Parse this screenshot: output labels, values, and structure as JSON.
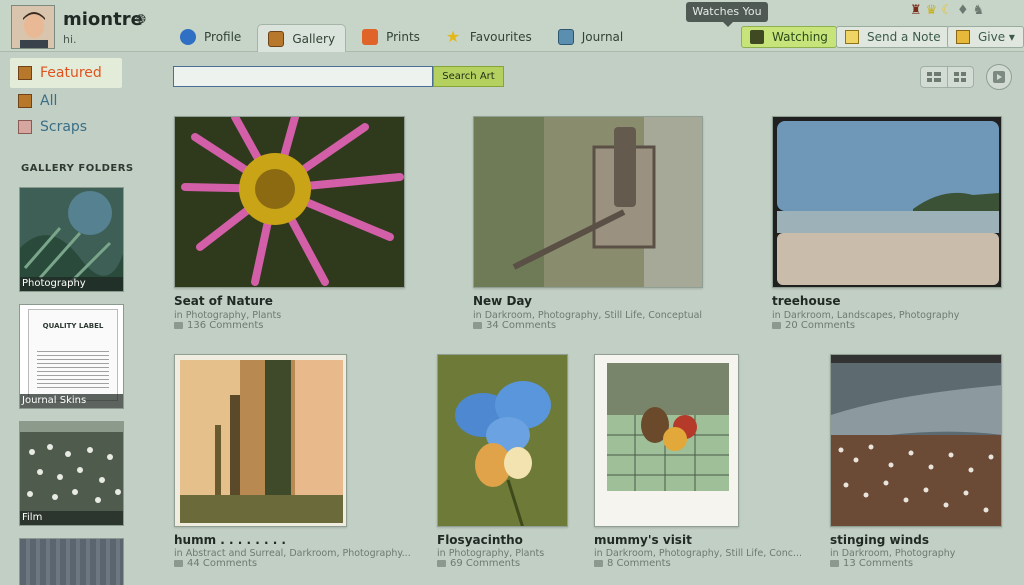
{
  "header": {
    "username": "miontre",
    "user_badge": "❂",
    "tagline": "hi.",
    "tooltip": "Watches You",
    "tabs": [
      {
        "label": "Profile"
      },
      {
        "label": "Gallery"
      },
      {
        "label": "Prints"
      },
      {
        "label": "Favourites"
      },
      {
        "label": "Journal"
      }
    ],
    "actions": {
      "watching": "Watching",
      "send_note": "Send a Note",
      "give": "Give ▾"
    }
  },
  "sidebar": {
    "items": [
      {
        "label": "Featured"
      },
      {
        "label": "All"
      },
      {
        "label": "Scraps"
      }
    ],
    "folders_title": "GALLERY FOLDERS",
    "folders": [
      {
        "label": "Photography"
      },
      {
        "label": "Journal Skins",
        "doc_title": "QUALITY LABEL"
      },
      {
        "label": "Film"
      },
      {
        "label": ""
      }
    ]
  },
  "search": {
    "placeholder": "",
    "button_label": "Search Art"
  },
  "gallery": {
    "in_label": "in",
    "items": [
      {
        "title": "Seat of Nature",
        "categories": "Photography, Plants",
        "comments": "136 Comments"
      },
      {
        "title": "New Day",
        "categories": "Darkroom, Photography, Still Life, Conceptual",
        "comments": "34 Comments"
      },
      {
        "title": "treehouse",
        "categories": "Darkroom, Landscapes, Photography",
        "comments": "20 Comments"
      },
      {
        "title": "humm . . . . . . . .",
        "categories": "Abstract and Surreal, Darkroom, Photography...",
        "comments": "44 Comments"
      },
      {
        "title": "Flosyacintho",
        "categories": "Photography, Plants",
        "comments": "69 Comments"
      },
      {
        "title": "mummy's visit",
        "categories": "Darkroom, Photography, Still Life, Conc...",
        "comments": "8 Comments"
      },
      {
        "title": "stinging winds",
        "categories": "Darkroom, Photography",
        "comments": "13 Comments"
      }
    ]
  },
  "colors": {
    "background": "#c2cfc4",
    "accent_active": "#e0531e",
    "link": "#3a6f87",
    "watch_button": "#c6e47a"
  }
}
